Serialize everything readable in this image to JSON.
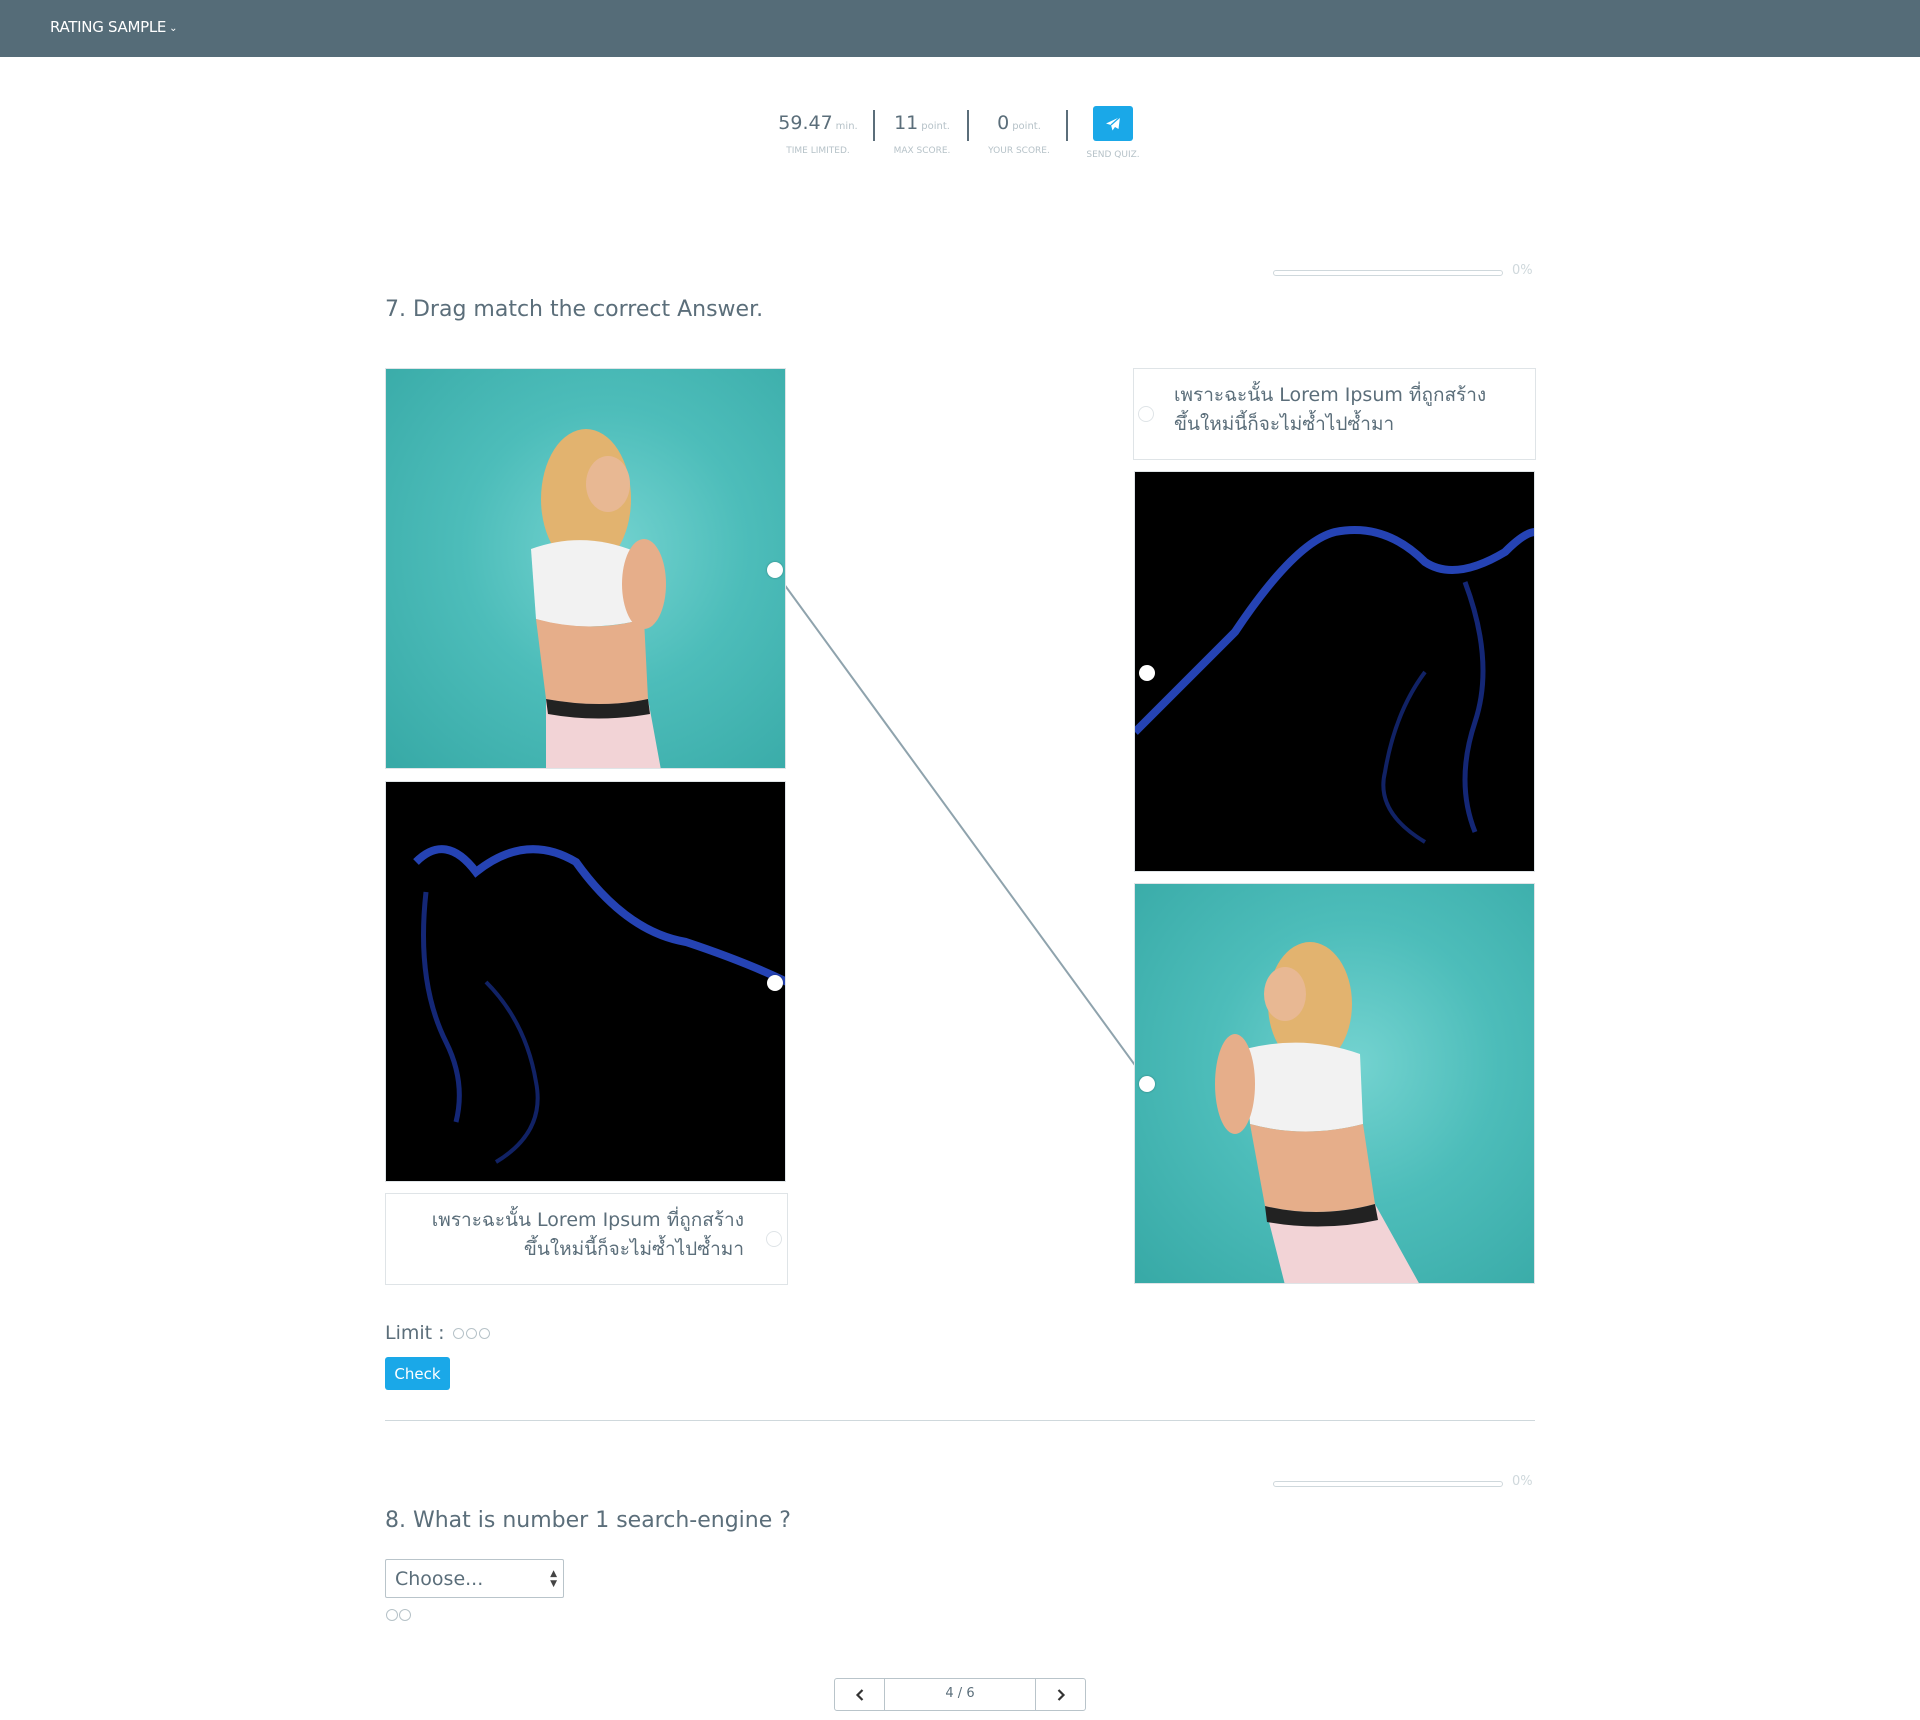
{
  "header": {
    "menu_label": "RATING SAMPLE"
  },
  "stats": [
    {
      "value": "59.47",
      "unit": "min.",
      "caption": "TIME LIMITED."
    },
    {
      "value": "11",
      "unit": "point.",
      "caption": "MAX SCORE."
    },
    {
      "value": "0",
      "unit": "point.",
      "caption": "YOUR SCORE."
    }
  ],
  "send": {
    "caption": "SEND QUIZ.",
    "icon": "paper-plane-icon"
  },
  "question7": {
    "title": "7. Drag match the correct Answer.",
    "progress": {
      "percent": 0,
      "label": "0%"
    },
    "left_items": [
      {
        "type": "image",
        "depicts": "woman-on-teal-background"
      },
      {
        "type": "image",
        "depicts": "blue-lit-silhouette-on-black"
      },
      {
        "type": "text",
        "text": "เพราะฉะนั้น Lorem Ipsum ที่ถูกสร้างขึ้นใหม่นี้ก็จะไม่ซ้ำไปซ้ำมา"
      }
    ],
    "right_items": [
      {
        "type": "text",
        "text": "เพราะฉะนั้น Lorem Ipsum ที่ถูกสร้างขึ้นใหม่นี้ก็จะไม่ซ้ำไปซ้ำมา"
      },
      {
        "type": "image",
        "depicts": "blue-lit-silhouette-on-black"
      },
      {
        "type": "image",
        "depicts": "woman-on-teal-background"
      }
    ],
    "limit_label": "Limit :",
    "limit_count": 3,
    "check_label": "Check"
  },
  "question8": {
    "title": "8. What is number 1 search-engine ?",
    "progress": {
      "percent": 0,
      "label": "0%"
    },
    "select_value": "Choose...",
    "limit_count": 2
  },
  "pagination": {
    "current": "4 / 6"
  }
}
